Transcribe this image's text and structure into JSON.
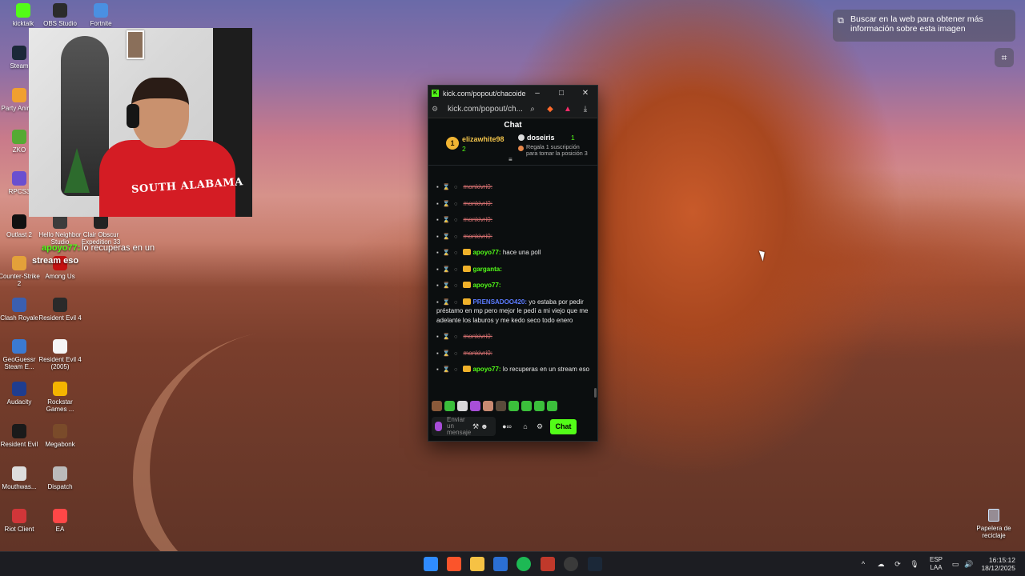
{
  "desktop": {
    "icons": [
      {
        "label": "kicktalk",
        "color": "#53fc18"
      },
      {
        "label": "OBS Studio",
        "color": "#2b2b2b"
      },
      {
        "label": "Fortnite",
        "color": "#4a90e2"
      },
      {
        "label": "Steam",
        "color": "#1b2838"
      },
      {
        "label": "Party Animal",
        "color": "#f0a030"
      },
      {
        "label": "ZKO",
        "color": "#55aa33"
      },
      {
        "label": "RPCS3",
        "color": "#6a4fd0"
      },
      {
        "label": "Outlast 2",
        "color": "#111111"
      },
      {
        "label": "Hello Neighbor Studio",
        "color": "#3c3c3c"
      },
      {
        "label": "Clair Obscur Expedition 33",
        "color": "#222222"
      },
      {
        "label": "Counter-Strike 2",
        "color": "#e3a13a"
      },
      {
        "label": "Among Us",
        "color": "#c51111"
      },
      {
        "label": "Clash Royale",
        "color": "#3b5fb0"
      },
      {
        "label": "Resident Evil 4",
        "color": "#2a2a2a"
      },
      {
        "label": "GeoGuessr Steam E...",
        "color": "#3b7ad1"
      },
      {
        "label": "Resident Evil 4 (2005)",
        "color": "#f5f5f5"
      },
      {
        "label": "Audacity",
        "color": "#1f3d8f"
      },
      {
        "label": "Rockstar Games ...",
        "color": "#f4b400"
      },
      {
        "label": "Resident Evil",
        "color": "#1a1a1a"
      },
      {
        "label": "Megabonk",
        "color": "#7a4b2a"
      },
      {
        "label": "Mouthwas...",
        "color": "#dddddd"
      },
      {
        "label": "Dispatch",
        "color": "#bbbbbb"
      },
      {
        "label": "Riot Client",
        "color": "#d13639"
      },
      {
        "label": "EA",
        "color": "#ff4747"
      }
    ],
    "recycle_bin": "Papelera de reciclaje"
  },
  "overlay": {
    "stream_text_1": "stream eso",
    "stream_user": "apoyo77:",
    "stream_text_2": "lo recuperas en un",
    "shirt_text": "SOUTH ALABAMA"
  },
  "lens": {
    "tooltip": "Buscar en la web para obtener más información sobre esta imagen"
  },
  "popup": {
    "title": "kick.com/popout/chacoide/...",
    "url": "kick.com/popout/ch...",
    "chat_header": "Chat",
    "pinned": {
      "rank": "1",
      "user1": "elizawhite98",
      "count1": "2",
      "user2": "doseiris",
      "count2": "1",
      "gift_text": "Regala 1 suscripción para tomar la posición 3"
    },
    "messages": [
      {
        "user": "monkivri0:",
        "text": "",
        "deleted": true
      },
      {
        "user": "monkivri0:",
        "text": "",
        "deleted": true
      },
      {
        "user": "monkivri0:",
        "text": "",
        "deleted": true
      },
      {
        "user": "monkivri0:",
        "text": "",
        "deleted": true
      },
      {
        "user": "apoyo77:",
        "text": "hace una poll",
        "color": "#53fc18"
      },
      {
        "user": "garganta:",
        "text": "",
        "color": "#53fc18"
      },
      {
        "user": "apoyo77:",
        "text": "",
        "color": "#53fc18"
      },
      {
        "user": "PRENSADOO420:",
        "text": "yo estaba por pedir préstamo en mp pero mejor le pedí a mi viejo que me adelante los laburos y me kedo seco todo enero",
        "color": "#5b7bff"
      },
      {
        "user": "monkivri0:",
        "text": "",
        "deleted": true
      },
      {
        "user": "monkivri0:",
        "text": "",
        "deleted": true
      },
      {
        "user": "apoyo77:",
        "text": "lo recuperas en un stream eso",
        "color": "#53fc18"
      }
    ],
    "input_placeholder": "Enviar un mensaje",
    "chat_button": "Chat",
    "accent": "#53fc18"
  },
  "taskbar": {
    "lang_1": "ESP",
    "lang_2": "LAA",
    "time": "16:15:12",
    "date": "18/12/2025"
  }
}
